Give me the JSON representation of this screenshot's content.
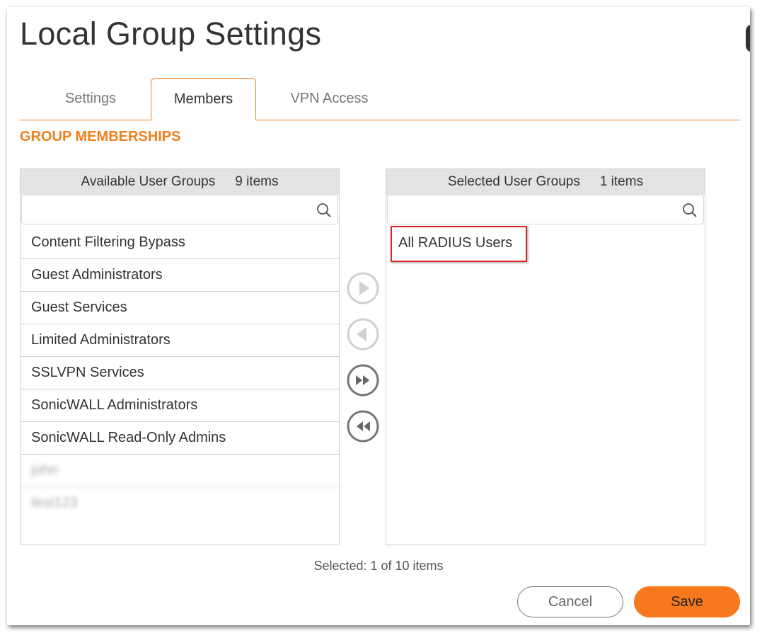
{
  "dialog": {
    "title": "Local Group Settings"
  },
  "tabs": [
    {
      "label": "Settings",
      "active": false
    },
    {
      "label": "Members",
      "active": true
    },
    {
      "label": "VPN Access",
      "active": false
    }
  ],
  "section": {
    "label": "GROUP MEMBERSHIPS"
  },
  "available": {
    "header": "Available User Groups",
    "count": "9 items",
    "search_placeholder": "",
    "items": [
      "Content Filtering Bypass",
      "Guest Administrators",
      "Guest Services",
      "Limited Administrators",
      "SSLVPN Services",
      "SonicWALL Administrators",
      "SonicWALL Read-Only Admins",
      "john",
      "test123"
    ]
  },
  "selected": {
    "header": "Selected User Groups",
    "count": "1 items",
    "search_placeholder": "",
    "items": [
      "All RADIUS Users"
    ]
  },
  "status": "Selected: 1 of 10 items",
  "buttons": {
    "cancel": "Cancel",
    "save": "Save"
  },
  "colors": {
    "accent": "#f07f1d",
    "save_button": "#f7781d",
    "highlight_border": "#d9262b"
  }
}
